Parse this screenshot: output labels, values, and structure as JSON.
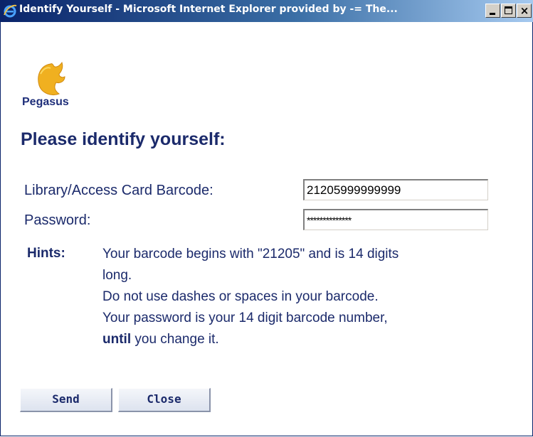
{
  "window": {
    "title": "Identify Yourself - Microsoft Internet Explorer provided by -= The...",
    "close_glyph": "×"
  },
  "logo": {
    "text": "Pegasus",
    "color": "#f0b020"
  },
  "heading": "Please identify yourself:",
  "form": {
    "barcode_label": "Library/Access Card Barcode:",
    "barcode_value": "21205999999999",
    "password_label": "Password:",
    "password_value": "**************"
  },
  "hints": {
    "label": "Hints:",
    "line1": "Your barcode begins with \"21205\" and is 14 digits",
    "line2": "long.",
    "line3": "Do not use dashes or spaces in your barcode.",
    "line4": "Your password is your 14 digit barcode number,",
    "line5_bold": "until",
    "line5_rest": " you change it."
  },
  "buttons": {
    "send": "Send",
    "close": "Close"
  },
  "colors": {
    "text": "#1b2a6b",
    "titlebar_start": "#0a246a"
  }
}
